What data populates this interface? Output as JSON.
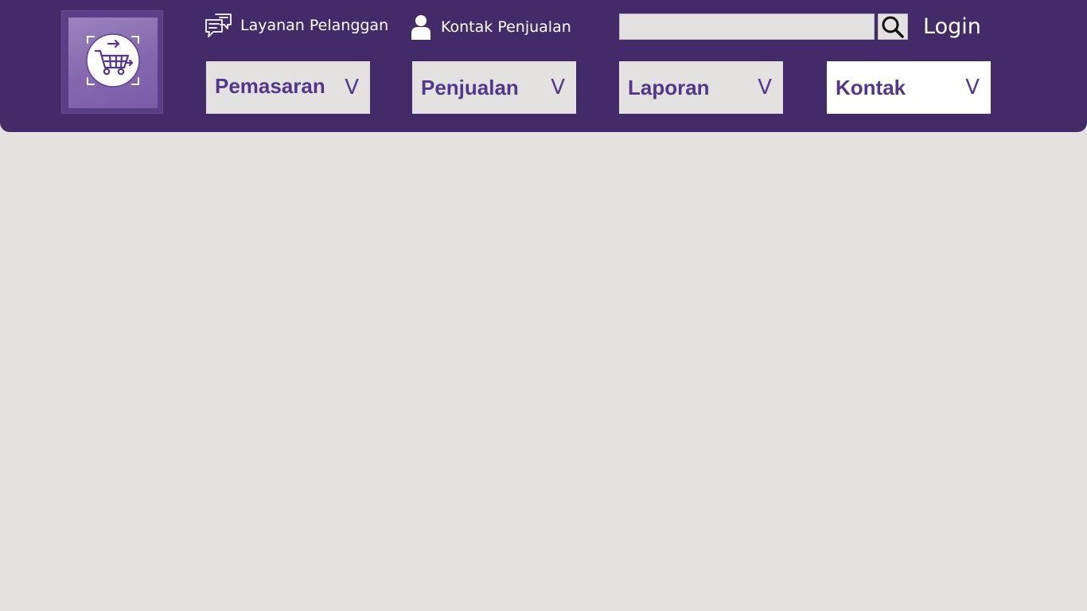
{
  "header": {
    "background_color": "#432a68",
    "logo": {
      "icon": "shopping-cart-icon"
    },
    "top_links": [
      {
        "label": "Layanan Pelanggan",
        "icon": "chat-bubbles-icon"
      },
      {
        "label": "Kontak Penjualan",
        "icon": "person-icon"
      }
    ],
    "search": {
      "value": "",
      "placeholder": "",
      "button_icon": "search-icon"
    },
    "login_label": "Login"
  },
  "nav": {
    "items": [
      {
        "label": "Pemasaran",
        "chevron": "V",
        "active": false
      },
      {
        "label": "Penjualan",
        "chevron": "V",
        "active": false
      },
      {
        "label": "Laporan",
        "chevron": "V",
        "active": false
      },
      {
        "label": "Kontak",
        "chevron": "V",
        "active": true
      }
    ],
    "text_color": "#54378a"
  },
  "page": {
    "background_color": "#e3e2e1"
  }
}
